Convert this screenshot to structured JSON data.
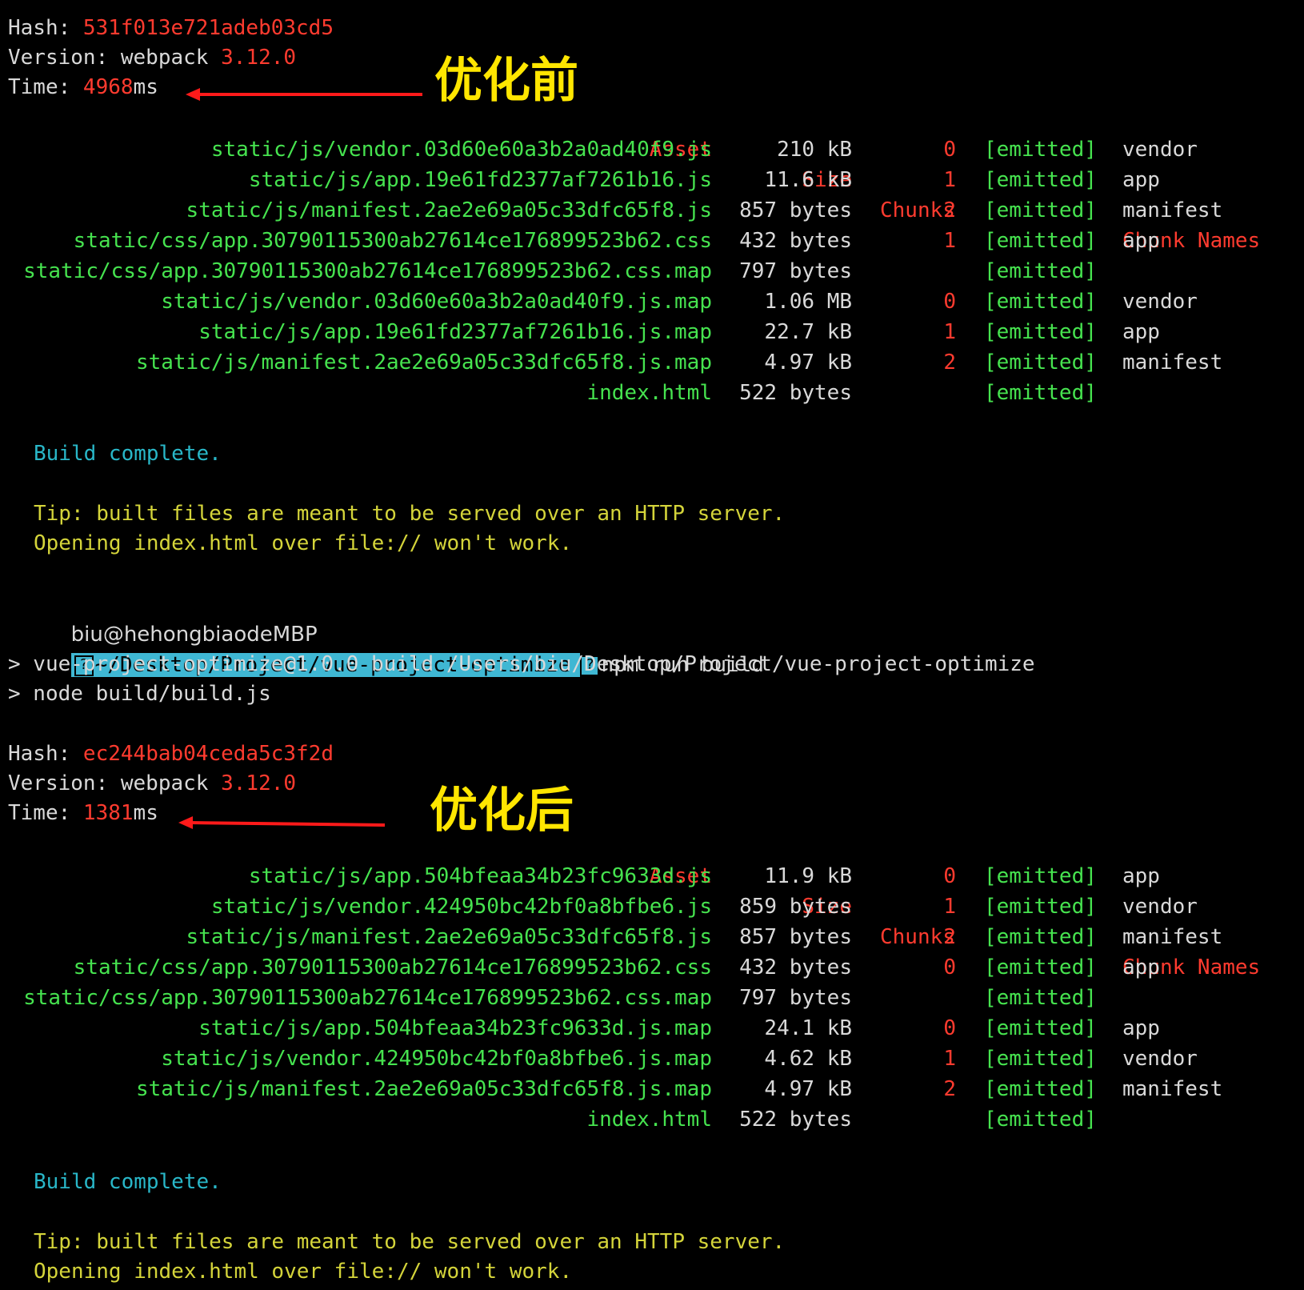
{
  "before": {
    "hash_label": "Hash: ",
    "hash": "531f013e721adeb03cd5",
    "version_label": "Version: webpack ",
    "version": "3.12.0",
    "time_label": "Time: ",
    "time": "4968",
    "time_unit": "ms",
    "annotation": "优化前",
    "headers": {
      "asset": "Asset",
      "size": "Size",
      "chunks": "Chunks",
      "names": "Chunk Names"
    },
    "rows": [
      {
        "asset": "static/js/vendor.03d60e60a3b2a0ad40f9.js",
        "size": "210 kB",
        "chunk": "0",
        "emitted": "[emitted]",
        "name": "vendor"
      },
      {
        "asset": "static/js/app.19e61fd2377af7261b16.js",
        "size": "11.6 kB",
        "chunk": "1",
        "emitted": "[emitted]",
        "name": "app"
      },
      {
        "asset": "static/js/manifest.2ae2e69a05c33dfc65f8.js",
        "size": "857 bytes",
        "chunk": "2",
        "emitted": "[emitted]",
        "name": "manifest"
      },
      {
        "asset": "static/css/app.30790115300ab27614ce176899523b62.css",
        "size": "432 bytes",
        "chunk": "1",
        "emitted": "[emitted]",
        "name": "app"
      },
      {
        "asset": "static/css/app.30790115300ab27614ce176899523b62.css.map",
        "size": "797 bytes",
        "chunk": "",
        "emitted": "[emitted]",
        "name": ""
      },
      {
        "asset": "static/js/vendor.03d60e60a3b2a0ad40f9.js.map",
        "size": "1.06 MB",
        "chunk": "0",
        "emitted": "[emitted]",
        "name": "vendor"
      },
      {
        "asset": "static/js/app.19e61fd2377af7261b16.js.map",
        "size": "22.7 kB",
        "chunk": "1",
        "emitted": "[emitted]",
        "name": "app"
      },
      {
        "asset": "static/js/manifest.2ae2e69a05c33dfc65f8.js.map",
        "size": "4.97 kB",
        "chunk": "2",
        "emitted": "[emitted]",
        "name": "manifest"
      },
      {
        "asset": "index.html",
        "size": "522 bytes",
        "chunk": "",
        "emitted": "[emitted]",
        "name": ""
      }
    ],
    "build_complete": "Build complete.",
    "tip1": "Tip: built files are meant to be served over an HTTP server.",
    "tip2": "Opening index.html over file:// won't work."
  },
  "prompt": {
    "user": "biu@hehongbiaodeMBP",
    "glyph": "?",
    "path": "~/Desktop/Project/vue-project-optimize",
    "command": "npm run build"
  },
  "npm_output": {
    "line1": "> vue-project-optimize@1.0.0 build /Users/biu/Desktop/Project/vue-project-optimize",
    "line2": "> node build/build.js"
  },
  "after": {
    "hash_label": "Hash: ",
    "hash": "ec244bab04ceda5c3f2d",
    "version_label": "Version: webpack ",
    "version": "3.12.0",
    "time_label": "Time: ",
    "time": "1381",
    "time_unit": "ms",
    "annotation": "优化后",
    "headers": {
      "asset": "Asset",
      "size": "Size",
      "chunks": "Chunks",
      "names": "Chunk Names"
    },
    "rows": [
      {
        "asset": "static/js/app.504bfeaa34b23fc9633d.js",
        "size": "11.9 kB",
        "chunk": "0",
        "emitted": "[emitted]",
        "name": "app"
      },
      {
        "asset": "static/js/vendor.424950bc42bf0a8bfbe6.js",
        "size": "859 bytes",
        "chunk": "1",
        "emitted": "[emitted]",
        "name": "vendor"
      },
      {
        "asset": "static/js/manifest.2ae2e69a05c33dfc65f8.js",
        "size": "857 bytes",
        "chunk": "2",
        "emitted": "[emitted]",
        "name": "manifest"
      },
      {
        "asset": "static/css/app.30790115300ab27614ce176899523b62.css",
        "size": "432 bytes",
        "chunk": "0",
        "emitted": "[emitted]",
        "name": "app"
      },
      {
        "asset": "static/css/app.30790115300ab27614ce176899523b62.css.map",
        "size": "797 bytes",
        "chunk": "",
        "emitted": "[emitted]",
        "name": ""
      },
      {
        "asset": "static/js/app.504bfeaa34b23fc9633d.js.map",
        "size": "24.1 kB",
        "chunk": "0",
        "emitted": "[emitted]",
        "name": "app"
      },
      {
        "asset": "static/js/vendor.424950bc42bf0a8bfbe6.js.map",
        "size": "4.62 kB",
        "chunk": "1",
        "emitted": "[emitted]",
        "name": "vendor"
      },
      {
        "asset": "static/js/manifest.2ae2e69a05c33dfc65f8.js.map",
        "size": "4.97 kB",
        "chunk": "2",
        "emitted": "[emitted]",
        "name": "manifest"
      },
      {
        "asset": "index.html",
        "size": "522 bytes",
        "chunk": "",
        "emitted": "[emitted]",
        "name": ""
      }
    ],
    "build_complete": "Build complete.",
    "tip1": "Tip: built files are meant to be served over an HTTP server.",
    "tip2": "Opening index.html over file:// won't work."
  },
  "colors": {
    "background": "#000000",
    "text": "#d9d9d9",
    "red": "#ff3b2f",
    "green": "#46e34f",
    "cyan": "#29b7c8",
    "yellow": "#d4d43a",
    "annotation": "#ffe600",
    "prompt_path_bg": "#3fb7d3"
  }
}
